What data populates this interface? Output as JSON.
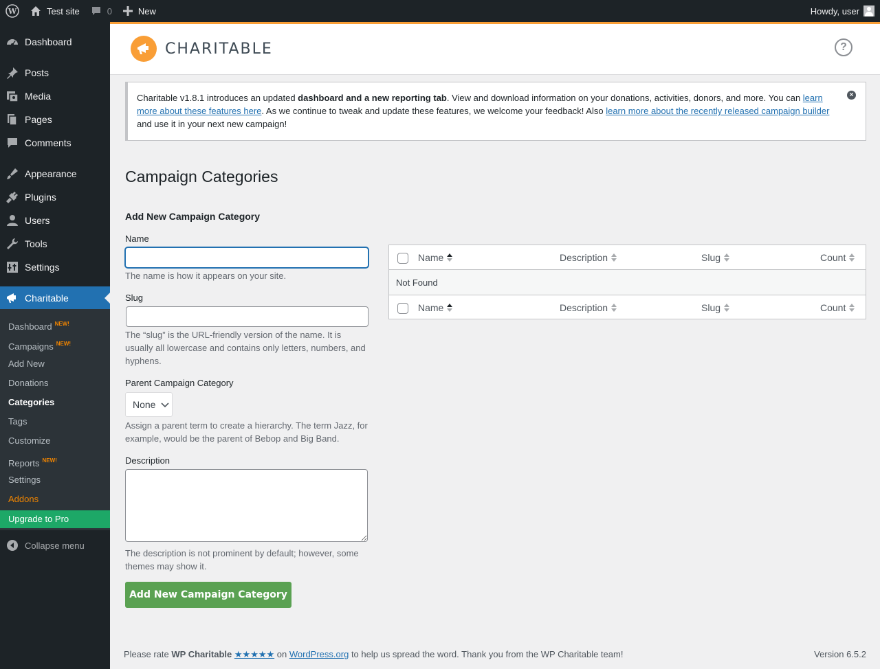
{
  "adminbar": {
    "site_name": "Test site",
    "comments_count": "0",
    "new_label": "New",
    "howdy": "Howdy, user"
  },
  "sidebar": {
    "items": [
      {
        "label": "Dashboard",
        "icon": "dashboard-icon"
      },
      {
        "label": "Posts",
        "icon": "pin-icon"
      },
      {
        "label": "Media",
        "icon": "media-icon"
      },
      {
        "label": "Pages",
        "icon": "pages-icon"
      },
      {
        "label": "Comments",
        "icon": "comment-icon"
      },
      {
        "label": "Appearance",
        "icon": "brush-icon"
      },
      {
        "label": "Plugins",
        "icon": "plugin-icon"
      },
      {
        "label": "Users",
        "icon": "users-icon"
      },
      {
        "label": "Tools",
        "icon": "wrench-icon"
      },
      {
        "label": "Settings",
        "icon": "settings-icon"
      },
      {
        "label": "Charitable",
        "icon": "megaphone-icon"
      }
    ],
    "submenu": [
      {
        "label": "Dashboard",
        "badge": "NEW!"
      },
      {
        "label": "Campaigns",
        "badge": "NEW!"
      },
      {
        "label": "Add New"
      },
      {
        "label": "Donations"
      },
      {
        "label": "Categories"
      },
      {
        "label": "Tags"
      },
      {
        "label": "Customize"
      },
      {
        "label": "Reports",
        "badge": "NEW!"
      },
      {
        "label": "Settings"
      },
      {
        "label": "Addons"
      }
    ],
    "upgrade": "Upgrade to Pro",
    "collapse": "Collapse menu"
  },
  "header": {
    "logo_text": "CHARITABLE",
    "help": "?"
  },
  "notice": {
    "t1": "Charitable v1.8.1 introduces an updated ",
    "t2": "dashboard and a new reporting tab",
    "t3": ". View and download information on your donations, activities, donors, and more. You can ",
    "link1": "learn more about these features here",
    "t4": ". As we continue to tweak and update these features, we welcome your feedback! Also ",
    "link2": "learn more about the recently released campaign builder",
    "t5": " and use it in your next new campaign!"
  },
  "page_title": "Campaign Categories",
  "form": {
    "title": "Add New Campaign Category",
    "name_label": "Name",
    "name_value": "",
    "name_desc": "The name is how it appears on your site.",
    "slug_label": "Slug",
    "slug_value": "",
    "slug_desc": "The “slug” is the URL-friendly version of the name. It is usually all lowercase and contains only letters, numbers, and hyphens.",
    "parent_label": "Parent Campaign Category",
    "parent_value": "None",
    "parent_desc": "Assign a parent term to create a hierarchy. The term Jazz, for example, would be the parent of Bebop and Big Band.",
    "desc_label": "Description",
    "desc_value": "",
    "desc_desc": "The description is not prominent by default; however, some themes may show it.",
    "submit": "Add New Campaign Category"
  },
  "table": {
    "columns": [
      "Name",
      "Description",
      "Slug",
      "Count"
    ],
    "empty": "Not Found"
  },
  "footer": {
    "t1": "Please rate ",
    "brand": "WP Charitable",
    "stars": "★★★★★",
    "t2": " on ",
    "link": "WordPress.org",
    "t3": " to help us spread the word. Thank you from the WP Charitable team!",
    "version": "Version 6.5.2"
  },
  "colors": {
    "accent": "#2271b1",
    "charitable_orange": "#f99e36",
    "upgrade_green": "#1da867",
    "submit_green": "#5aa152"
  }
}
